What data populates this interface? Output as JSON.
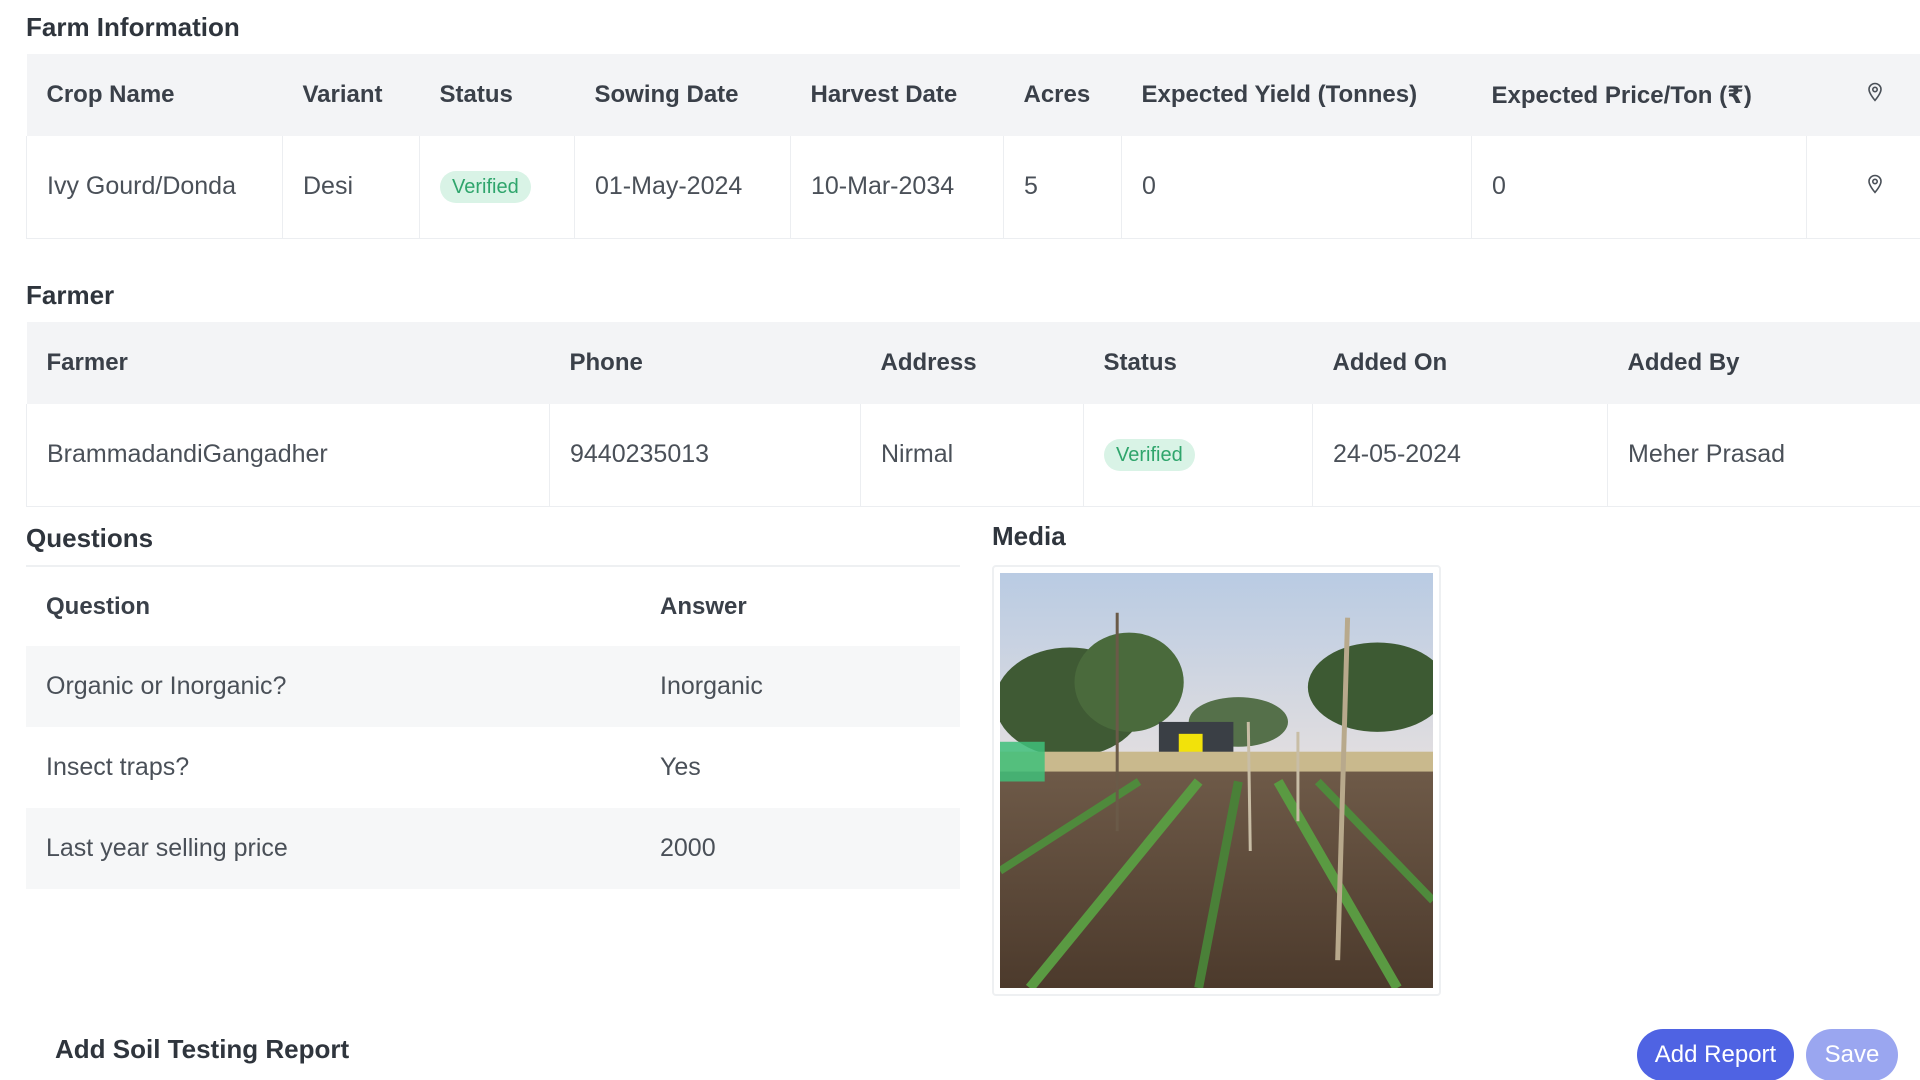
{
  "farm_info": {
    "title": "Farm Information",
    "headers": [
      "Crop Name",
      "Variant",
      "Status",
      "Sowing Date",
      "Harvest Date",
      "Acres",
      "Expected Yield (Tonnes)",
      "Expected Price/Ton (₹)"
    ],
    "row": {
      "crop_name": "Ivy Gourd/Donda",
      "variant": "Desi",
      "status": "Verified",
      "sowing_date": "01-May-2024",
      "harvest_date": "10-Mar-2034",
      "acres": "5",
      "expected_yield": "0",
      "expected_price": "0"
    },
    "location_icon": "map-pin-icon"
  },
  "farmer": {
    "title": "Farmer",
    "headers": [
      "Farmer",
      "Phone",
      "Address",
      "Status",
      "Added On",
      "Added By"
    ],
    "row": {
      "farmer": "BrammadandiGangadher",
      "phone": "9440235013",
      "address": "Nirmal",
      "status": "Verified",
      "added_on": "24-05-2024",
      "added_by": "Meher Prasad"
    }
  },
  "questions": {
    "title": "Questions",
    "headers": [
      "Question",
      "Answer"
    ],
    "rows": [
      {
        "question": "Organic or Inorganic?",
        "answer": "Inorganic"
      },
      {
        "question": "Insect traps?",
        "answer": "Yes"
      },
      {
        "question": "Last year selling price",
        "answer": "2000"
      }
    ]
  },
  "media": {
    "title": "Media"
  },
  "report": {
    "title": "Add Soil Testing Report",
    "add_report_label": "Add Report",
    "save_label": "Save"
  },
  "colors": {
    "primary": "#4f63e3",
    "primary_disabled": "#9aa6f0",
    "verified_bg": "#d9f3e6",
    "verified_text": "#2fa56c",
    "header_bg": "#f3f4f6"
  }
}
